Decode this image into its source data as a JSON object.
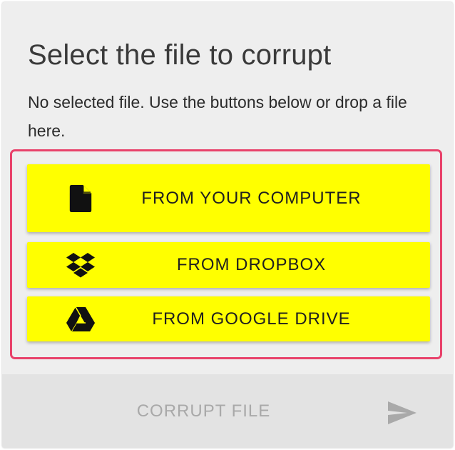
{
  "panel": {
    "title": "Select the file to corrupt",
    "description": "No selected file. Use the buttons below or drop a file here."
  },
  "sources": [
    {
      "label": "FROM YOUR COMPUTER",
      "icon": "file-icon"
    },
    {
      "label": "FROM DROPBOX",
      "icon": "dropbox-icon"
    },
    {
      "label": "FROM GOOGLE DRIVE",
      "icon": "google-drive-icon"
    }
  ],
  "action": {
    "label": "CORRUPT FILE",
    "icon": "send-icon",
    "disabled": true
  },
  "colors": {
    "button_bg": "#ffff00",
    "highlight_border": "#e8416a",
    "disabled_text": "#a9a9a9"
  }
}
